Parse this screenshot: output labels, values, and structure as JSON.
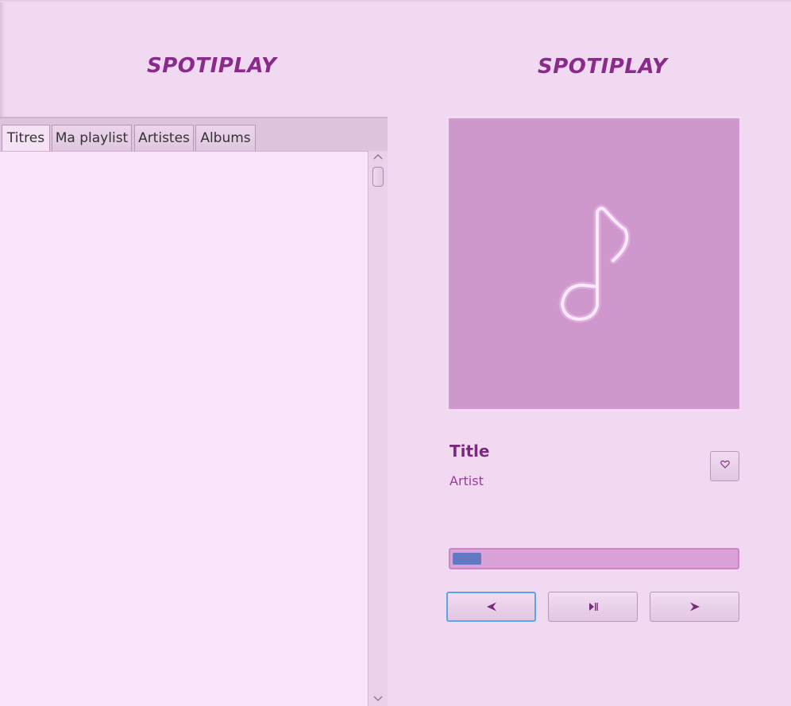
{
  "left_panel": {
    "app_title": "SPOTIPLAY",
    "tabs": [
      {
        "label": "Titres",
        "active": true
      },
      {
        "label": "Ma playlist",
        "active": false
      },
      {
        "label": "Artistes",
        "active": false
      },
      {
        "label": "Albums",
        "active": false
      }
    ]
  },
  "right_panel": {
    "app_title": "SPOTIPLAY",
    "album_art_icon": "music-note-icon",
    "track": {
      "title": "Title",
      "artist": "Artist"
    },
    "like_icon": "heart-icon",
    "progress": {
      "value": 0.1
    },
    "controls": {
      "previous_icon": "previous-arrow-icon",
      "play_pause_icon": "play-pause-icon",
      "next_icon": "next-arrow-icon"
    }
  },
  "colors": {
    "background": "#f1daf1",
    "accent": "#8a2a8a",
    "album_art_bg": "#cf98cd",
    "progress_fill": "#6278c2",
    "focus_border": "#5aa6e6"
  }
}
